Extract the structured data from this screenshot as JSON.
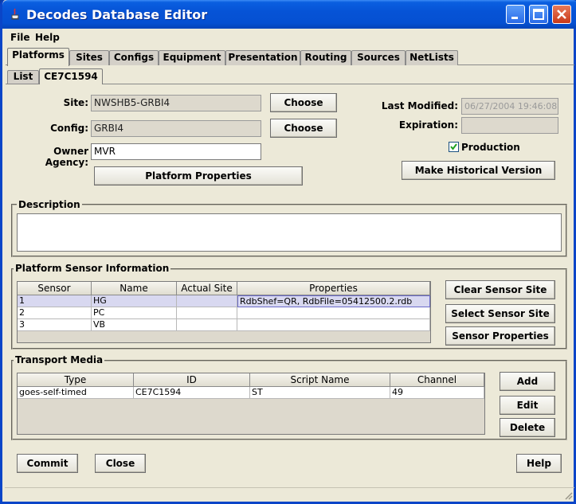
{
  "window": {
    "title": "Decodes Database Editor"
  },
  "menu": [
    "File",
    "Help"
  ],
  "tabs": [
    "Platforms",
    "Sites",
    "Configs",
    "Equipment",
    "Presentation",
    "Routing",
    "Sources",
    "NetLists"
  ],
  "subtabs": [
    "List",
    "CE7C1594"
  ],
  "form": {
    "site_label": "Site:",
    "site_value": "NWSHB5-GRBI4",
    "config_label": "Config:",
    "config_value": "GRBI4",
    "owner_label": "Owner Agency:",
    "owner_value": "MVR",
    "choose_label": "Choose",
    "platform_properties_label": "Platform Properties",
    "last_modified_label": "Last Modified:",
    "last_modified_value": "06/27/2004 19:46:08",
    "expiration_label": "Expiration:",
    "expiration_value": "",
    "production_label": "Production",
    "production_checked": true,
    "historical_label": "Make Historical Version"
  },
  "description": {
    "title": "Description",
    "value": ""
  },
  "sensors": {
    "title": "Platform Sensor Information",
    "columns": [
      "Sensor",
      "Name",
      "Actual Site",
      "Properties"
    ],
    "rows": [
      {
        "sensor": "1",
        "name": "HG",
        "site": "",
        "properties": "RdbShef=QR, RdbFile=05412500.2.rdb"
      },
      {
        "sensor": "2",
        "name": "PC",
        "site": "",
        "properties": ""
      },
      {
        "sensor": "3",
        "name": "VB",
        "site": "",
        "properties": ""
      }
    ],
    "clear_label": "Clear Sensor Site",
    "select_label": "Select Sensor Site",
    "props_label": "Sensor Properties"
  },
  "transport": {
    "title": "Transport Media",
    "columns": [
      "Type",
      "ID",
      "Script Name",
      "Channel"
    ],
    "rows": [
      {
        "type": "goes-self-timed",
        "id": "CE7C1594",
        "script": "ST",
        "channel": "49"
      }
    ],
    "add_label": "Add",
    "edit_label": "Edit",
    "delete_label": "Delete"
  },
  "footer": {
    "commit_label": "Commit",
    "close_label": "Close",
    "help_label": "Help"
  }
}
